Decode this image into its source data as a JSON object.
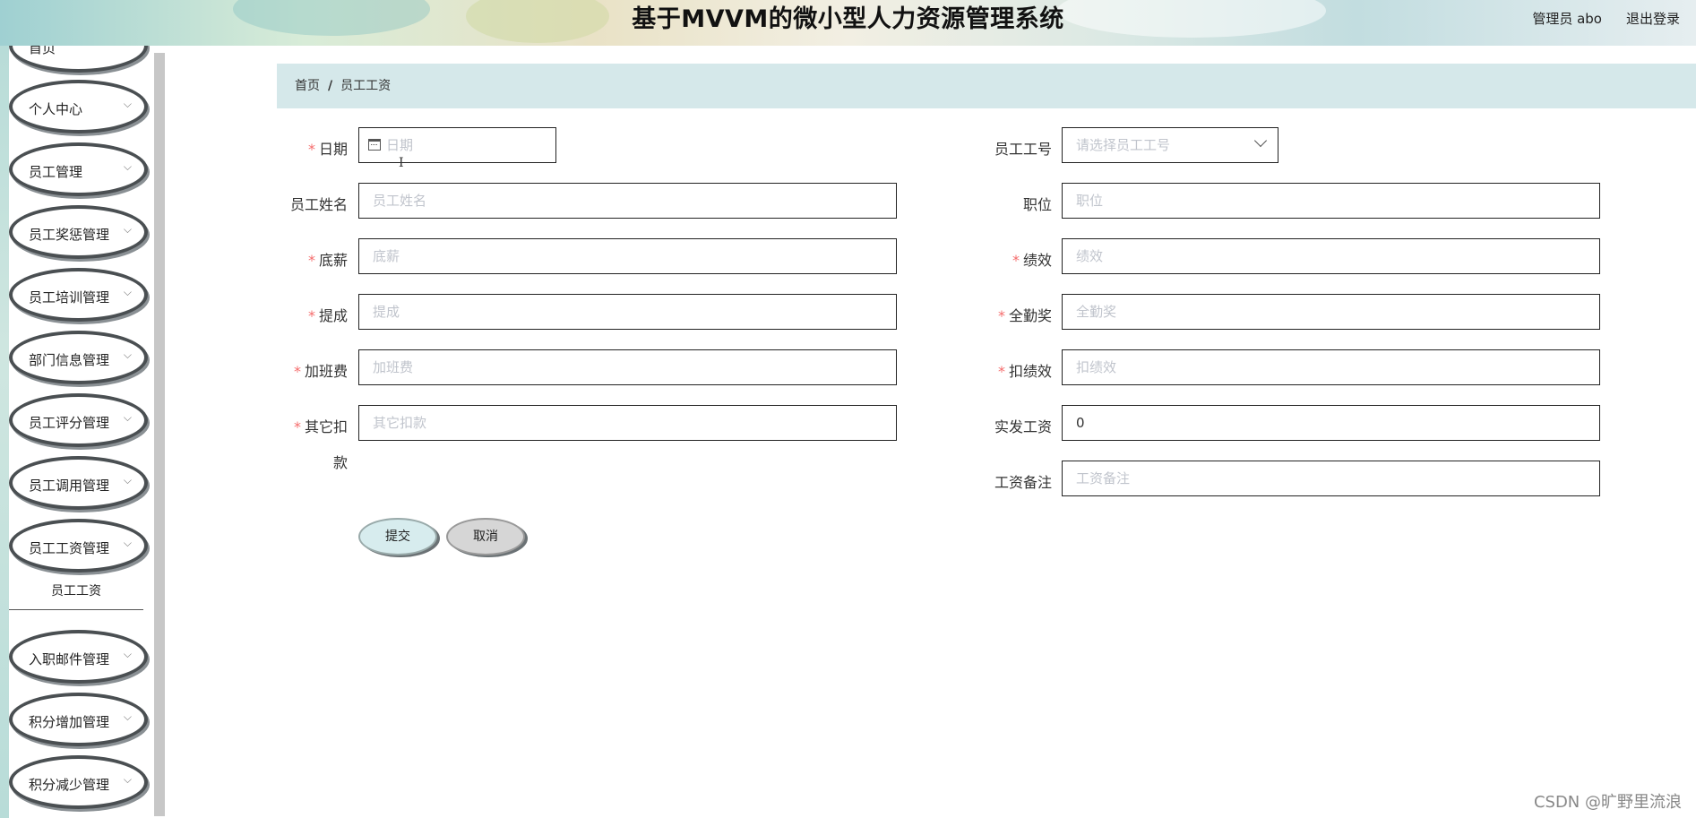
{
  "header": {
    "title": "基于MVVM的微小型人力资源管理系统",
    "user": "管理员 abo",
    "logout": "退出登录"
  },
  "sidebar": {
    "items": [
      {
        "label": "首页"
      },
      {
        "label": "个人中心"
      },
      {
        "label": "员工管理"
      },
      {
        "label": "员工奖惩管理"
      },
      {
        "label": "员工培训管理"
      },
      {
        "label": "部门信息管理"
      },
      {
        "label": "员工评分管理"
      },
      {
        "label": "员工调用管理"
      },
      {
        "label": "员工工资管理"
      },
      {
        "label": "入职邮件管理"
      },
      {
        "label": "积分增加管理"
      },
      {
        "label": "积分减少管理"
      }
    ],
    "submenu_active": "员工工资"
  },
  "breadcrumb": {
    "home": "首页",
    "sep": "/",
    "current": "员工工资"
  },
  "form": {
    "date": {
      "label": "日期",
      "placeholder": "日期"
    },
    "emp_id": {
      "label": "员工工号",
      "placeholder": "请选择员工工号"
    },
    "emp_name": {
      "label": "员工姓名",
      "placeholder": "员工姓名"
    },
    "position": {
      "label": "职位",
      "placeholder": "职位"
    },
    "base_salary": {
      "label": "底薪",
      "placeholder": "底薪"
    },
    "performance": {
      "label": "绩效",
      "placeholder": "绩效"
    },
    "commission": {
      "label": "提成",
      "placeholder": "提成"
    },
    "attendance_bonus": {
      "label": "全勤奖",
      "placeholder": "全勤奖"
    },
    "overtime": {
      "label": "加班费",
      "placeholder": "加班费"
    },
    "perf_deduction": {
      "label": "扣绩效",
      "placeholder": "扣绩效"
    },
    "other_deduction": {
      "label_line1": "其它扣",
      "label_line2": "款",
      "placeholder": "其它扣款"
    },
    "actual_salary": {
      "label": "实发工资",
      "value": "0"
    },
    "salary_note": {
      "label": "工资备注",
      "placeholder": "工资备注"
    },
    "submit": "提交",
    "cancel": "取消"
  },
  "watermark": "CSDN @旷野里流浪"
}
